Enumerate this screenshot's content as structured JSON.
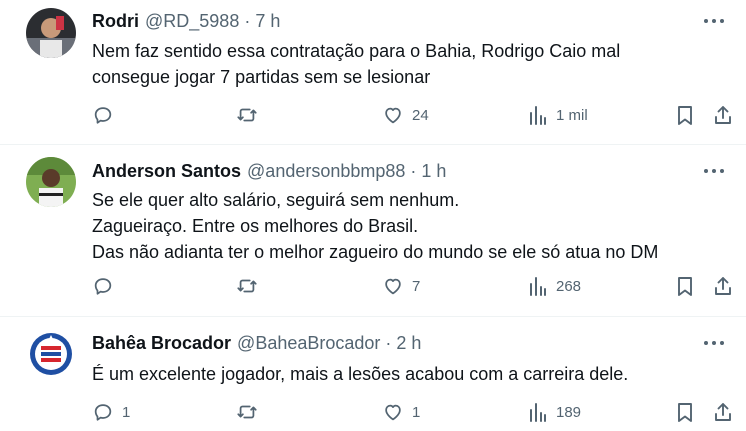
{
  "tweets": [
    {
      "name": "Rodri",
      "handle": "@RD_5988",
      "separator": "·",
      "time": "7 h",
      "lines": [
        "Nem faz sentido essa contratação para o Bahia, Rodrigo Caio mal",
        "consegue jogar 7 partidas sem se lesionar"
      ],
      "replies": "",
      "retweets": "",
      "likes": "24",
      "views": "1 mil"
    },
    {
      "name": "Anderson Santos",
      "handle": "@andersonbbmp88",
      "separator": "·",
      "time": "1 h",
      "lines": [
        "Se ele quer alto salário, seguirá sem nenhum.",
        "Zagueiraço. Entre os melhores do Brasil.",
        "Das não adianta ter o melhor zagueiro do mundo se ele só atua no DM"
      ],
      "replies": "",
      "retweets": "",
      "likes": "7",
      "views": "268"
    },
    {
      "name": "Bahêa Brocador",
      "handle": "@BaheaBrocador",
      "separator": "·",
      "time": "2 h",
      "lines": [
        "É um excelente jogador, mais a lesões acabou com a carreira dele."
      ],
      "replies": "1",
      "retweets": "",
      "likes": "1",
      "views": "189"
    }
  ],
  "icons": {
    "reply": "reply-icon",
    "retweet": "retweet-icon",
    "like": "heart-icon",
    "views": "views-chart-icon",
    "bookmark": "bookmark-icon",
    "share": "share-icon",
    "more": "more-options-icon"
  },
  "colors": {
    "text": "#0f1419",
    "secondary": "#536471",
    "divider": "#eff3f4",
    "bahia_blue": "#1f4fa3",
    "bahia_red": "#d6262e"
  }
}
